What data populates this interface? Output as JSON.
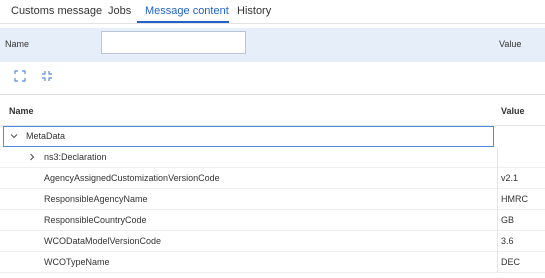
{
  "tabs": [
    {
      "label": "Customs message",
      "active": false
    },
    {
      "label": "Jobs",
      "active": false
    },
    {
      "label": "Message content",
      "active": true
    },
    {
      "label": "History",
      "active": false
    }
  ],
  "colors": {
    "accent": "#1f63c7",
    "filter_bg": "#e6eef9",
    "selection_border": "#4c8ce0"
  },
  "filter": {
    "name_label": "Name",
    "name_value": "",
    "value_label": "Value"
  },
  "toolbar": {
    "expand_icon": "expand-all-icon",
    "collapse_icon": "collapse-all-icon"
  },
  "grid": {
    "columns": {
      "name": "Name",
      "value": "Value"
    },
    "rows": [
      {
        "name": "MetaData",
        "value": "",
        "expander": "chevron-down-icon",
        "selected": true
      },
      {
        "name": "ns3:Declaration",
        "value": "",
        "expander": "chevron-right-icon",
        "selected": false
      },
      {
        "name": "AgencyAssignedCustomizationVersionCode",
        "value": "v2.1",
        "expander": "",
        "selected": false
      },
      {
        "name": "ResponsibleAgencyName",
        "value": "HMRC",
        "expander": "",
        "selected": false
      },
      {
        "name": "ResponsibleCountryCode",
        "value": "GB",
        "expander": "",
        "selected": false
      },
      {
        "name": "WCODataModelVersionCode",
        "value": "3.6",
        "expander": "",
        "selected": false
      },
      {
        "name": "WCOTypeName",
        "value": "DEC",
        "expander": "",
        "selected": false
      }
    ]
  }
}
